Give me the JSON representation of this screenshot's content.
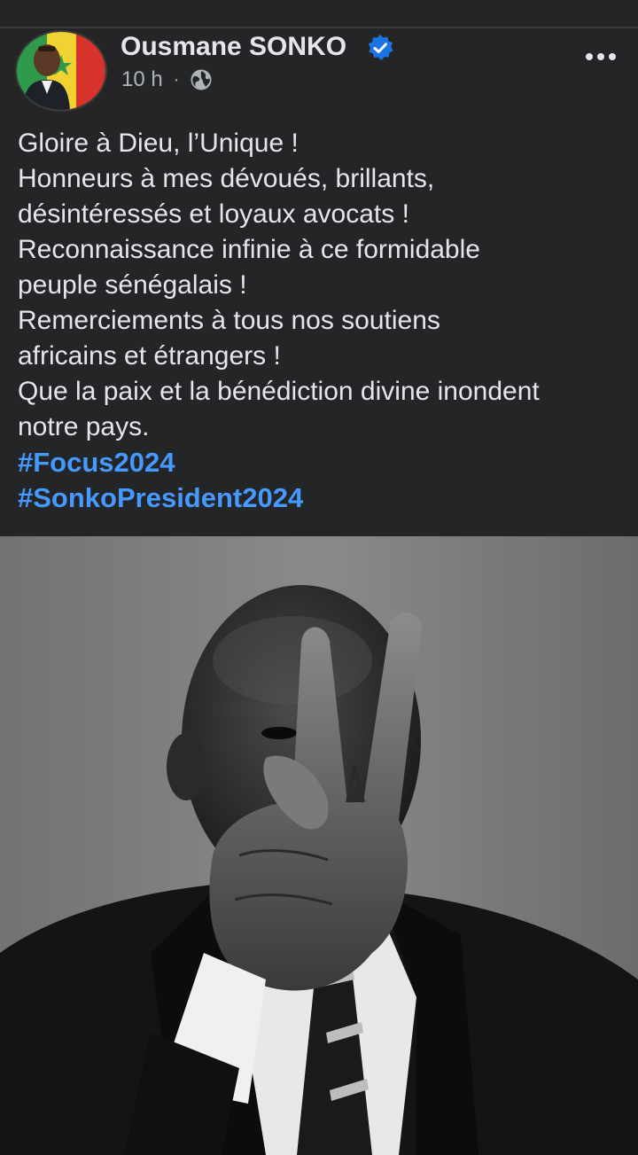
{
  "post": {
    "author": "Ousmane SONKO",
    "verified": true,
    "timestamp": "10 h",
    "separator": "·",
    "audience_icon": "globe-icon",
    "more_icon": "more-options-icon",
    "text_lines": [
      "Gloire à Dieu, l’Unique !",
      "Honneurs à mes dévoués, brillants,",
      "désintéressés et loyaux avocats !",
      "Reconnaissance infinie à ce formidable",
      "peuple sénégalais !",
      "Remerciements à tous nos soutiens",
      "africains et étrangers !",
      "Que la paix et la bénédiction divine inondent",
      "notre pays."
    ],
    "hashtags": [
      "#Focus2024",
      "#SonkoPresident2024"
    ]
  },
  "colors": {
    "background": "#242526",
    "text": "#e4e6eb",
    "secondary_text": "#b0b3b8",
    "link": "#4599ff",
    "verified_badge": "#1b74e4"
  }
}
